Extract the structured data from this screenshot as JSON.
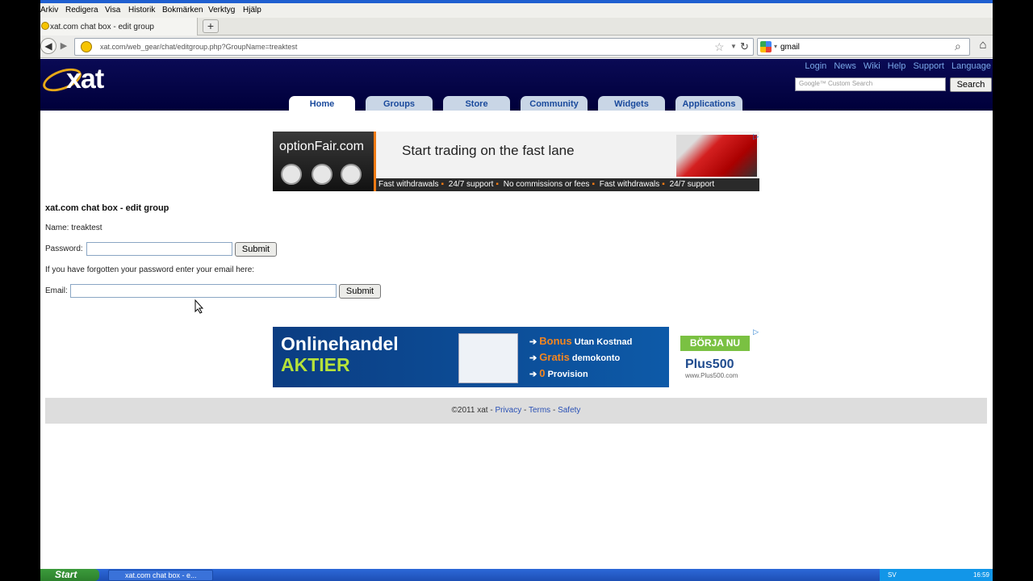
{
  "browser": {
    "menu": [
      "Arkiv",
      "Redigera",
      "Visa",
      "Historik",
      "Bokmärken",
      "Verktyg",
      "Hjälp"
    ],
    "tab_title": "xat.com chat box - edit group",
    "new_tab": "+",
    "url": "xat.com/web_gear/chat/editgroup.php?GroupName=treaktest",
    "search_query": "gmail"
  },
  "header": {
    "logo_text": "xat",
    "top_links": [
      "Login",
      "News",
      "Wiki",
      "Help",
      "Support",
      "Language"
    ],
    "custom_search_placeholder": "Custom Search",
    "custom_search_brand": "Google™",
    "search_button": "Search",
    "nav_tabs": [
      "Home",
      "Groups",
      "Store",
      "Community",
      "Widgets",
      "Applications"
    ],
    "active_tab": "Home"
  },
  "ad_top": {
    "brand": "optionFair.com",
    "headline": "Start trading on the fast lane",
    "strip": [
      "Fast withdrawals",
      "24/7 support",
      "No commissions or fees",
      "Fast withdrawals",
      "24/7 support"
    ]
  },
  "content": {
    "title": "xat.com chat box - edit group",
    "name_line": "Name: treaktest",
    "password_label": "Password:",
    "submit_label": "Submit",
    "forgot_text": "If you have forgotten your password enter your email here:",
    "email_label": "Email:"
  },
  "ad_bottom": {
    "title1": "Onlinehandel",
    "title2": "AKTIER",
    "bullets": [
      {
        "hl": "Bonus",
        "rest": "Utan Kostnad"
      },
      {
        "hl": "Gratis",
        "rest": "demokonto"
      },
      {
        "hl": "0",
        "rest": "Provision"
      }
    ],
    "cta": "BÖRJA NU",
    "brand": "Plus500",
    "site": "www.Plus500.com"
  },
  "footer": {
    "copyright": "©2011 xat - ",
    "links": [
      "Privacy",
      "Terms",
      "Safety"
    ]
  },
  "taskbar": {
    "start": "Start",
    "item": "xat.com chat box - e...",
    "lang": "SV",
    "time": "16:59"
  }
}
